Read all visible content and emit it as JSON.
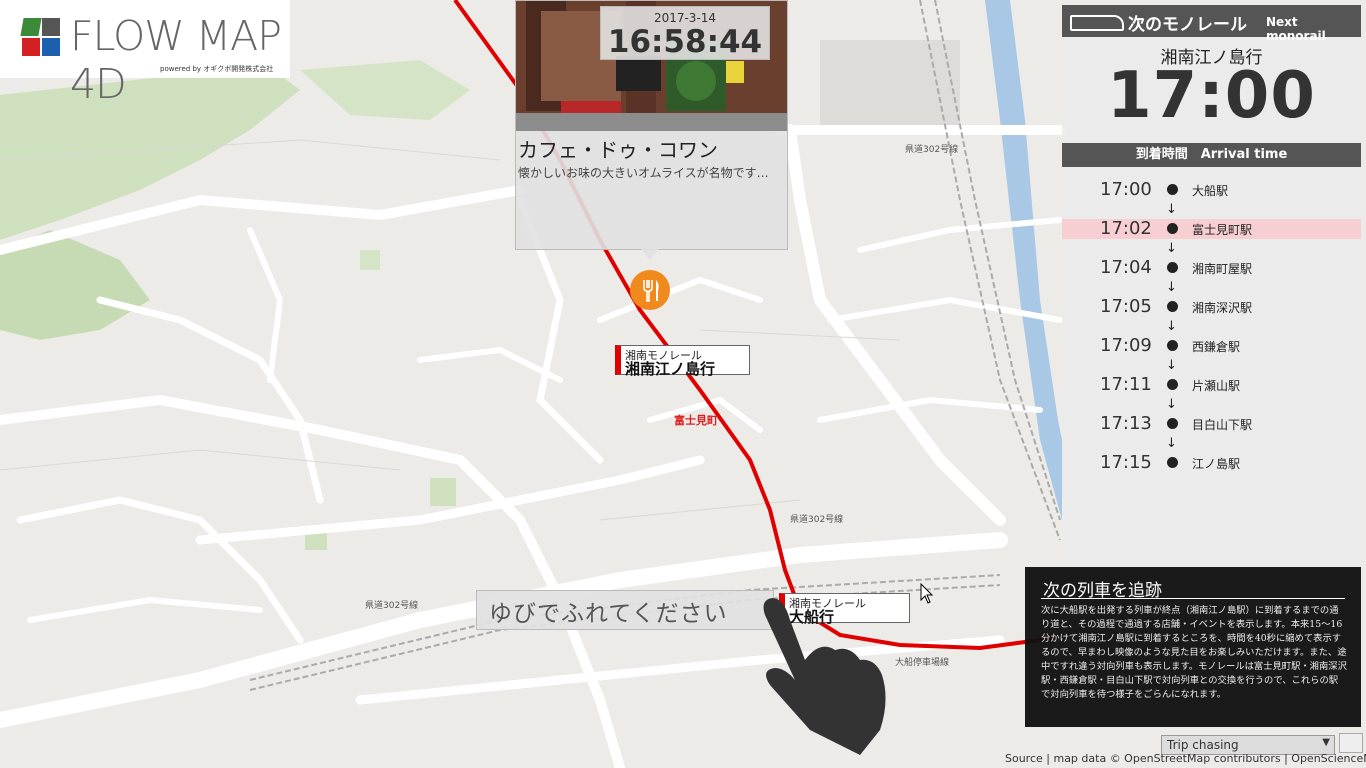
{
  "app": {
    "logo_text": "FLOW MAP 4D",
    "logo_powered": "powered by オギクボ開発株式会社"
  },
  "clock": {
    "date": "2017-3-14",
    "time": "16:58:44"
  },
  "poi": {
    "title": "カフェ・ドゥ・コワン",
    "description": "懐かしいお味の大きいオムライスが名物です…",
    "icon": "restaurant-icon",
    "pin_color": "#f08a1d"
  },
  "trains": [
    {
      "line": "湘南モノレール",
      "destination": "湘南江ノ島行"
    },
    {
      "line": "湘南モノレール",
      "destination": "大船行"
    }
  ],
  "map_labels": {
    "station": "富士見町",
    "road1": "県道302号線",
    "road2": "県道302号線",
    "road3": "県道302号線",
    "road4": "大船停車場線"
  },
  "touch_prompt": "ゆびでふれてください",
  "next_panel": {
    "title": "次のモノレール",
    "title_en": "Next monorail",
    "destination": "湘南江ノ島行",
    "departure": "17:00",
    "arrival_header": "到着時間　Arrival time",
    "stops": [
      {
        "time": "17:00",
        "name": "大船駅",
        "highlight": false
      },
      {
        "time": "17:02",
        "name": "富士見町駅",
        "highlight": true
      },
      {
        "time": "17:04",
        "name": "湘南町屋駅",
        "highlight": false
      },
      {
        "time": "17:05",
        "name": "湘南深沢駅",
        "highlight": false
      },
      {
        "time": "17:09",
        "name": "西鎌倉駅",
        "highlight": false
      },
      {
        "time": "17:11",
        "name": "片瀬山駅",
        "highlight": false
      },
      {
        "time": "17:13",
        "name": "目白山下駅",
        "highlight": false
      },
      {
        "time": "17:15",
        "name": "江ノ島駅",
        "highlight": false
      }
    ]
  },
  "info": {
    "title": "次の列車を追跡",
    "body": "次に大船駅を出発する列車が終点（湘南江ノ島駅）に到着するまでの通り道と、その過程で通過する店舗・イベントを表示します。本来15〜16分かけて湘南江ノ島駅に到着するところを、時間を40秒に縮めて表示するので、早まわし映像のような見た目をお楽しみいただけます。また、途中ですれ違う対向列車も表示します。モノレールは富士見町駅・湘南深沢駅・西鎌倉駅・目白山下駅で対向列車との交換を行うので、これらの駅で対向列車を待つ様子をごらんになれます。"
  },
  "mode_select": {
    "selected": "Trip chasing"
  },
  "attribution": "Source | map data © OpenStreetMap contributors | OpenScienceMap",
  "colors": {
    "route": "#e00000",
    "panel_header": "#555555",
    "highlight_row": "#f7cfd3"
  }
}
